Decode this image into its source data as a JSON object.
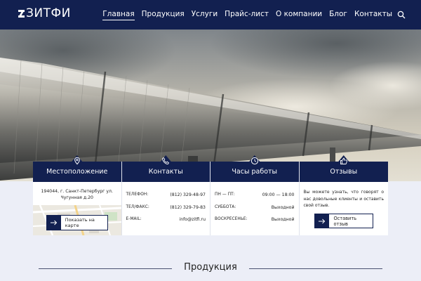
{
  "header": {
    "logo_text": "ЗИТФИ",
    "nav": [
      "Главная",
      "Продукция",
      "Услуги",
      "Прайс-лист",
      "О компании",
      "Блог",
      "Контакты"
    ],
    "active_index": 0,
    "search_icon": "search-icon"
  },
  "colors": {
    "brand": "#122050",
    "band": "#eceef7",
    "white": "#ffffff"
  },
  "cards": {
    "location": {
      "title": "Местоположение",
      "icon": "map-pin-icon",
      "address": "194044, г. Санкт-Петербург ул. Чугунная д.20",
      "button": "Показать на карте"
    },
    "contacts": {
      "title": "Контакты",
      "icon": "phone-icon",
      "rows": [
        {
          "k": "Телефон:",
          "v": "(812) 329-48-97"
        },
        {
          "k": "Тел/факс:",
          "v": "(812) 329-79-83"
        },
        {
          "k": "E-mail:",
          "v": "info@zitfi.ru"
        }
      ]
    },
    "hours": {
      "title": "Часы работы",
      "icon": "clock-icon",
      "rows": [
        {
          "k": "ПН — ПТ:",
          "v": "09:00 — 18:00"
        },
        {
          "k": "Суббота:",
          "v": "Выходной"
        },
        {
          "k": "Воскресенье:",
          "v": "Выходной"
        }
      ]
    },
    "reviews": {
      "title": "Отзывы",
      "icon": "thumbs-up-icon",
      "text": "Вы можете узнать, что говорят о нас довольные клиенты и оставить свой отзыв.",
      "button": "Оставить отзыв"
    }
  },
  "products_heading": "Продукция"
}
